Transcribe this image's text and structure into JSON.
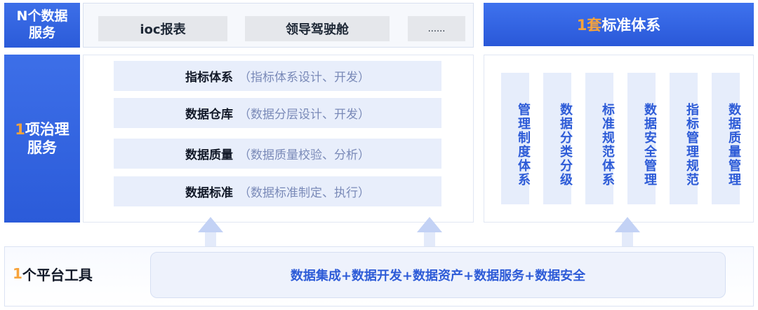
{
  "data_services": {
    "label_accent": "N",
    "label_rest_line1": "个数据",
    "label_line2": "服务",
    "items": [
      "ioc报表",
      "领导驾驶舱",
      "......"
    ]
  },
  "governance": {
    "label_accent": "1",
    "label_rest_line1": "项治理",
    "label_line2": "服务",
    "rows": [
      {
        "title": "指标体系",
        "detail": "（指标体系设计、开发）"
      },
      {
        "title": "数据仓库",
        "detail": "（数据分层设计、开发）"
      },
      {
        "title": "数据质量",
        "detail": "（数据质量校验、分析）"
      },
      {
        "title": "数据标准",
        "detail": "（数据标准制定、执行）"
      }
    ]
  },
  "standard_system": {
    "title_accent": "1套",
    "title_rest": "标准体系",
    "columns": [
      "管理制度体系",
      "数据分类分级",
      "标准规范体系",
      "数据安全管理",
      "指标管理规范",
      "数据质量管理"
    ]
  },
  "platform": {
    "label_accent": "1",
    "label_rest": "个平台工具",
    "tools": "数据集成+数据开发+数据资产+数据服务+数据安全"
  },
  "colors": {
    "primary_blue": "#2b5bd9",
    "accent_orange": "#f7a33b",
    "light_chip": "#e8eefb"
  }
}
